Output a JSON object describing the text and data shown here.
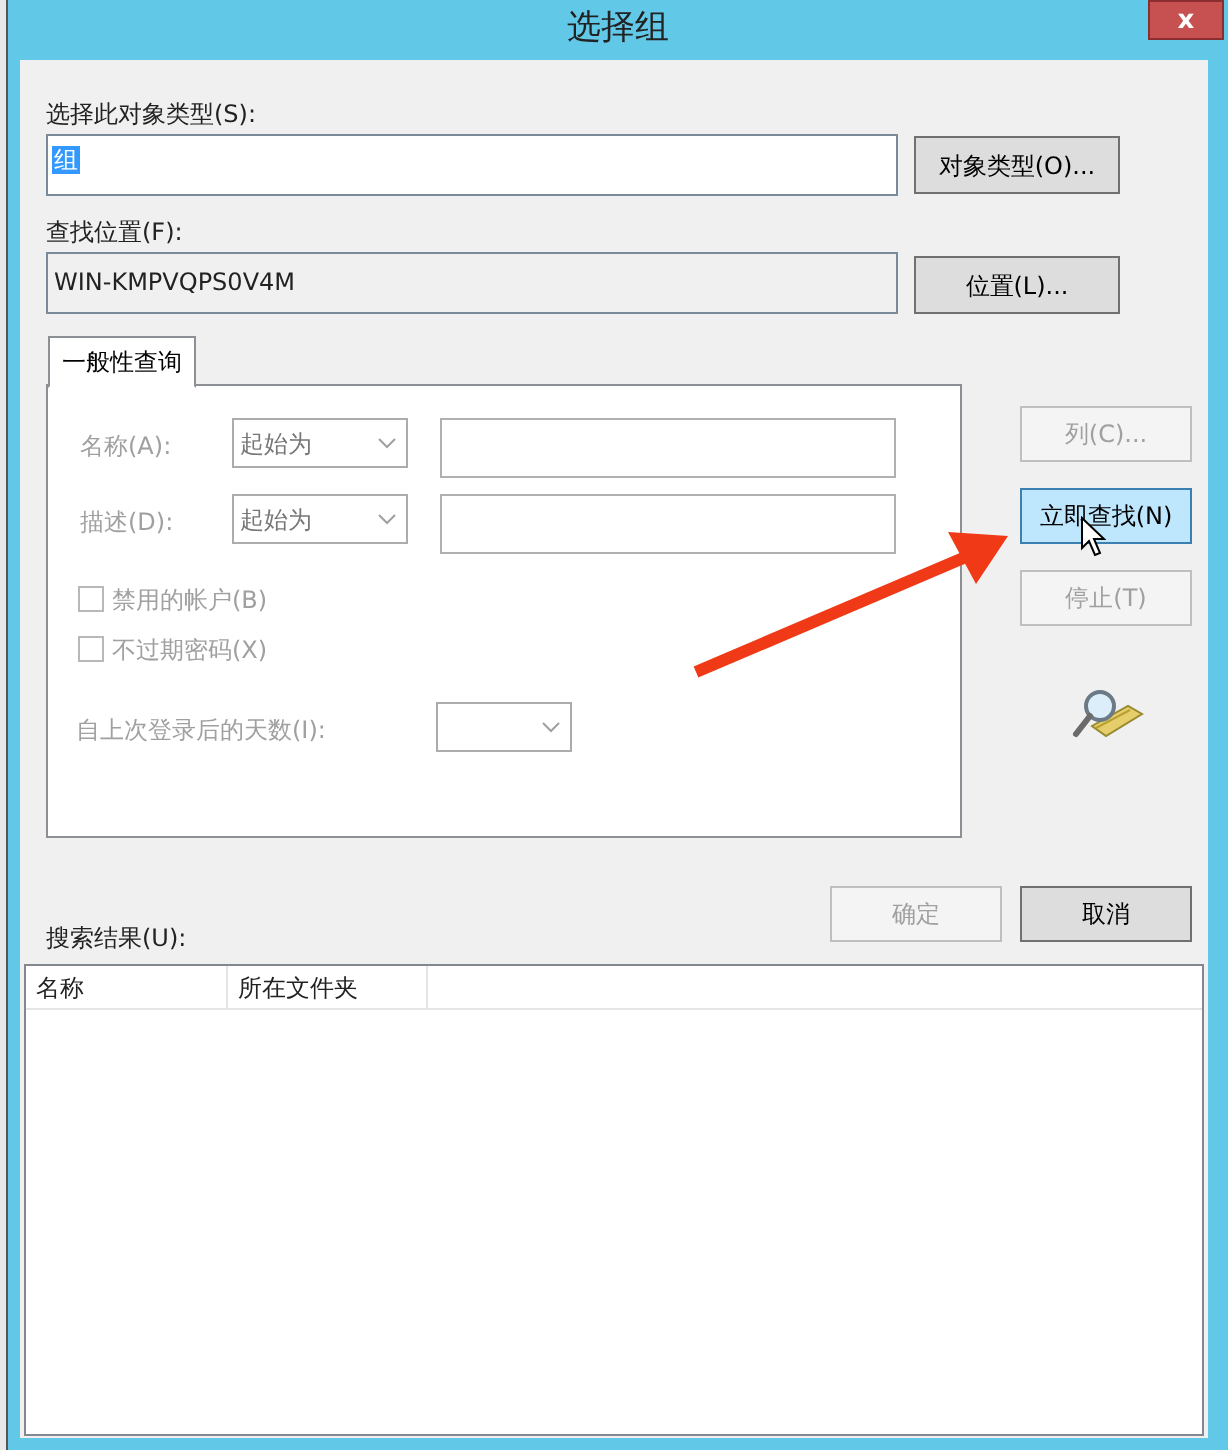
{
  "window": {
    "title": "选择组",
    "close": "x"
  },
  "object_type": {
    "label": "选择此对象类型(S):",
    "value": "组",
    "selected": true,
    "button": "对象类型(O)..."
  },
  "location": {
    "label": "查找位置(F):",
    "value": "WIN-KMPVQPS0V4M",
    "button": "位置(L)..."
  },
  "tabs": [
    {
      "label": "一般性查询",
      "selected": true
    }
  ],
  "query_rows": [
    {
      "label": "名称(A):",
      "operator": "起始为",
      "disabled": true
    },
    {
      "label": "描述(D):",
      "operator": "起始为",
      "disabled": true
    }
  ],
  "checkboxes": [
    {
      "label": "禁用的帐户(B)",
      "checked": false,
      "disabled": true
    },
    {
      "label": "不过期密码(X)",
      "checked": false,
      "disabled": true
    }
  ],
  "days_since_logon": {
    "label": "自上次登录后的天数(I):",
    "disabled": true
  },
  "side_buttons": [
    {
      "label": "列(C)...",
      "disabled": true,
      "focused": false
    },
    {
      "label": "立即查找(N)",
      "disabled": false,
      "focused": true
    },
    {
      "label": "停止(T)",
      "disabled": true,
      "focused": false
    }
  ],
  "dialog_buttons": [
    {
      "label": "确定",
      "disabled": true
    },
    {
      "label": "取消",
      "disabled": false
    }
  ],
  "results": {
    "label": "搜索结果(U):",
    "columns": [
      "名称",
      "所在文件夹"
    ]
  }
}
